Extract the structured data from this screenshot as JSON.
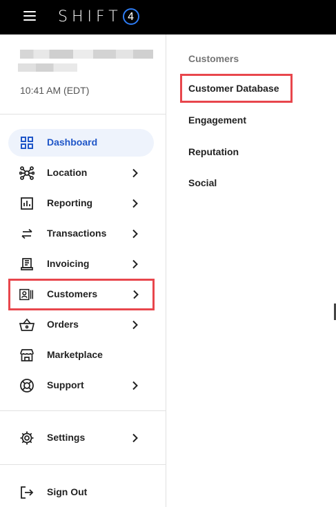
{
  "header": {
    "brand_text": "SHIFT",
    "brand_number": "4",
    "menu_icon": "hamburger-icon"
  },
  "user": {
    "time": "10:41 AM (EDT)"
  },
  "sidebar": {
    "items": [
      {
        "label": "Dashboard",
        "icon": "grid-icon",
        "chevron": false
      },
      {
        "label": "Location",
        "icon": "network-icon",
        "chevron": true
      },
      {
        "label": "Reporting",
        "icon": "bar-chart-icon",
        "chevron": true
      },
      {
        "label": "Transactions",
        "icon": "swap-arrows-icon",
        "chevron": true
      },
      {
        "label": "Invoicing",
        "icon": "receipt-icon",
        "chevron": true
      },
      {
        "label": "Customers",
        "icon": "contact-card-icon",
        "chevron": true
      },
      {
        "label": "Orders",
        "icon": "basket-icon",
        "chevron": true
      },
      {
        "label": "Marketplace",
        "icon": "storefront-icon",
        "chevron": false
      },
      {
        "label": "Support",
        "icon": "lifebuoy-icon",
        "chevron": true
      }
    ],
    "settings": {
      "label": "Settings",
      "icon": "gear-icon"
    },
    "signout": {
      "label": "Sign Out",
      "icon": "logout-icon"
    }
  },
  "submenu": {
    "title": "Customers",
    "items": [
      {
        "label": "Customer Database"
      },
      {
        "label": "Engagement"
      },
      {
        "label": "Reputation"
      },
      {
        "label": "Social"
      }
    ]
  },
  "colors": {
    "accent": "#1f56c8",
    "highlight": "#e8464c",
    "active_bg": "#eef3fc",
    "brand_ring": "#2e7df6"
  }
}
